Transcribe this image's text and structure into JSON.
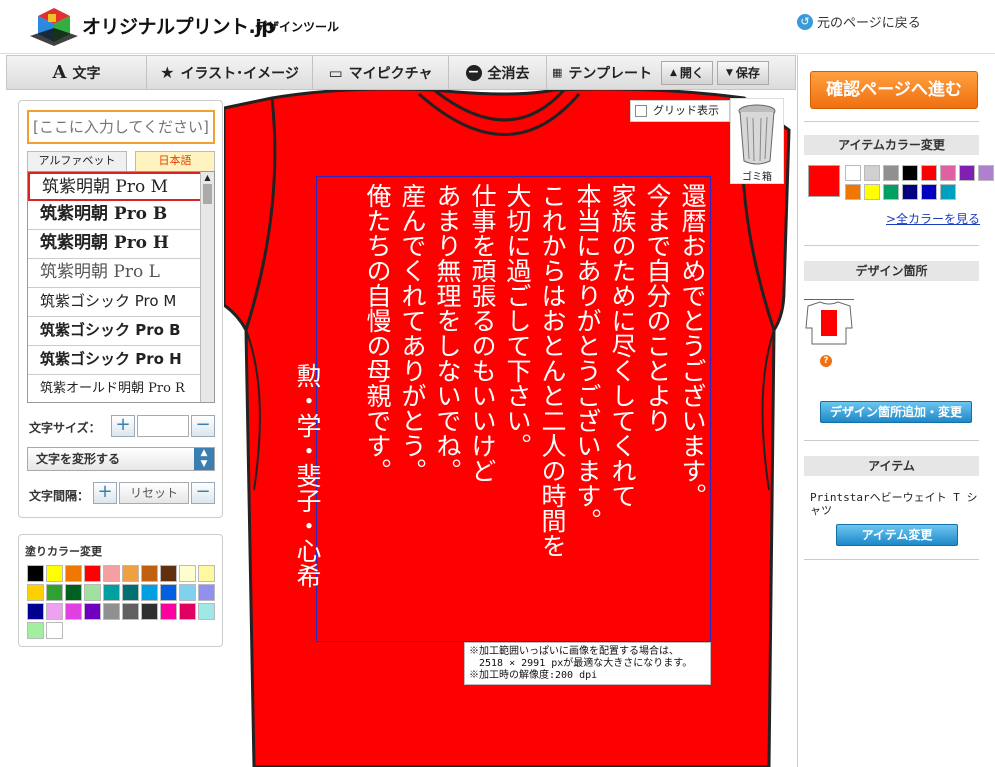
{
  "header": {
    "logo_text": "オリジナルプリント.jp",
    "logo_sub": "デザインツール",
    "back_link": "元のページに戻る",
    "back_icon": "refresh-arrow-icon"
  },
  "toolbar": {
    "text_tab": "文字",
    "illust_tab": "イラスト･イメージ",
    "mypicture_tab": "マイピクチャ",
    "clear_tab": "全消去",
    "template_tab": "テンプレート",
    "open_label": "開く",
    "save_label": "保存"
  },
  "left": {
    "input_placeholder": "[ここに入力してください]",
    "tab_alphabet": "アルファベット",
    "tab_japanese": "日本語",
    "fonts": [
      "筑紫明朝 Pro M",
      "筑紫明朝 Pro B",
      "筑紫明朝 Pro H",
      "筑紫明朝 Pro L",
      "筑紫ゴシック Pro M",
      "筑紫ゴシック Pro B",
      "筑紫ゴシック Pro H",
      "筑紫オールド明朝 Pro R"
    ],
    "size_label": "文字サイズ：",
    "transform_label": "文字を変形する",
    "spacing_label": "文字間隔：",
    "reset_label": "リセット",
    "plus": "+",
    "minus": "−"
  },
  "color_panel": {
    "title": "塗りカラー変更",
    "colors": [
      "#000000",
      "#ffff00",
      "#f07800",
      "#ff0000",
      "#f5a0a0",
      "#f0a040",
      "#c06010",
      "#603010",
      "#fffcd0",
      "#fff8a0",
      "#ffd000",
      "#30a030",
      "#006020",
      "#a0e0a0",
      "#00a0a0",
      "#007070",
      "#00a0e0",
      "#0060e0",
      "#80d0f0",
      "#9090f0",
      "#000090",
      "#f0a0f0",
      "#e040e0",
      "#7000c0",
      "#909090",
      "#606060",
      "#303030",
      "#ff00a0",
      "#e00060",
      "#a0e8e8",
      "#a0f0a0",
      "#ffffff"
    ]
  },
  "canvas": {
    "grid_label": "グリッド表示",
    "trash_label": "ゴミ箱",
    "shirt_color": "#ff0000",
    "design_lines": [
      "還暦おめでとうございます。",
      "今まで自分のことより",
      "家族のために尽くしてくれて",
      "本当にありがとうございます。",
      "これからはおとんと二人の時間を",
      "大切に過ごして下さい。",
      "仕事を頑張るのもいいけど",
      "あまり無理をしないでね。",
      "産んでくれてありがとう。",
      "俺たちの自慢の母親です。",
      "",
      "勲・学・斐子・心希"
    ],
    "note_lines": [
      "※加工範囲いっぱいに画像を配置する場合は、",
      "　2518 × 2991 pxが最適な大きさになります。",
      "※加工時の解像度:200 dpi"
    ]
  },
  "right": {
    "confirm_label": "確認ページへ進む",
    "item_color_title": "アイテムカラー変更",
    "selected_color": "#ff0000",
    "item_colors": [
      "#ffffff",
      "#d0d0d0",
      "#909090",
      "#000000",
      "#ff0000",
      "#e060a0",
      "#8020b0",
      "#b080d0",
      "#f07800",
      "#ffff00",
      "#00a060",
      "#000080",
      "#0000c0",
      "#00a0c0"
    ],
    "all_colors_link": ">全カラーを見る",
    "design_area_title": "デザイン箇所",
    "add_design_btn": "デザイン箇所追加・変更",
    "item_title": "アイテム",
    "item_name": "Printstarヘビーウェイト T シャツ",
    "item_change_btn": "アイテム変更"
  }
}
